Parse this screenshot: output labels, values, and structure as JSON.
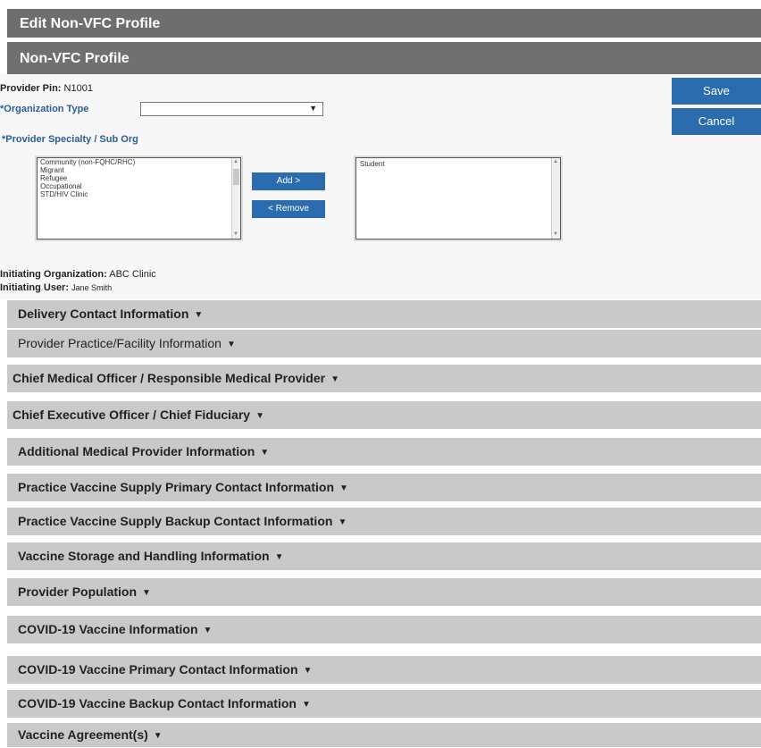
{
  "header": {
    "title": "Edit Non-VFC Profile"
  },
  "section": {
    "title": "Non-VFC Profile"
  },
  "form": {
    "provider_pin_label": "Provider Pin:",
    "provider_pin_value": "N1001",
    "org_type_label": "*Organization Type",
    "org_type_value": "",
    "specialty_label": "*Provider Specialty / Sub Org",
    "available_options": [
      "Community (non-FQHC/RHC)",
      "Migrant",
      "Refugee",
      "Occupational",
      "STD/HIV Clinic"
    ],
    "selected_options": [
      "Student"
    ],
    "add_label": "Add >",
    "remove_label": "< Remove",
    "initiating_org_label": "Initiating Organization:",
    "initiating_org_value": "ABC Clinic",
    "initiating_user_label": "Initiating User:",
    "initiating_user_value": "Jane Smith"
  },
  "actions": {
    "save_label": "Save",
    "cancel_label": "Cancel"
  },
  "accordion": [
    "Delivery Contact Information",
    "Provider Practice/Facility Information",
    "Chief Medical Officer / Responsible Medical Provider",
    "Chief Executive Officer / Chief Fiduciary",
    "Additional Medical Provider Information",
    "Practice Vaccine Supply Primary Contact Information",
    "Practice Vaccine Supply Backup Contact Information",
    "Vaccine Storage and Handling Information",
    "Provider Population",
    "COVID-19 Vaccine Information",
    "COVID-19 Vaccine Primary Contact Information",
    "COVID-19 Vaccine Backup Contact Information",
    "Vaccine Agreement(s)"
  ],
  "icons": {
    "accordion": "caret-down-icon",
    "select": "chevron-down-icon"
  },
  "colors": {
    "primary_button": "#2b6cae",
    "header_bg": "#6e6e6e",
    "accordion_bg": "#c9c9c9",
    "required_label": "#2a5d9a"
  }
}
